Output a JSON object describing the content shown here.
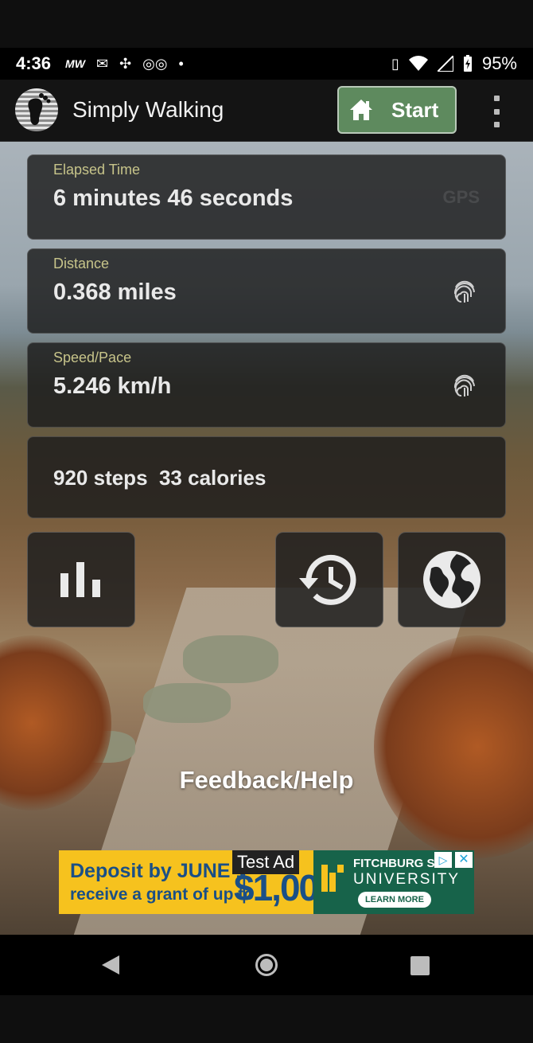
{
  "status_bar": {
    "time": "4:36",
    "battery": "95%",
    "left_icons": [
      "mw-icon",
      "gmail-icon",
      "pinwheel-icon",
      "voicemail-icon",
      "dot-icon"
    ],
    "right_icons": [
      "vibrate-icon",
      "wifi-icon",
      "signal-icon",
      "battery-charging-icon"
    ]
  },
  "app_bar": {
    "title": "Simply Walking",
    "start_label": "Start"
  },
  "cards": {
    "elapsed": {
      "label": "Elapsed Time",
      "value": "6 minutes 46 seconds",
      "gps": "GPS"
    },
    "distance": {
      "label": "Distance",
      "value": "0.368 miles"
    },
    "speed": {
      "label": "Speed/Pace",
      "value": "5.246 km/h"
    },
    "summary": {
      "text": "920 steps  33 calories"
    }
  },
  "buttons": {
    "stats_icon": "bar-chart-icon",
    "history_icon": "history-icon",
    "map_icon": "globe-icon"
  },
  "feedback": "Feedback/Help",
  "ad": {
    "test_label": "Test Ad",
    "line1": "Deposit by JUNE 1",
    "line2": "receive a grant of up to",
    "amount": "$1,000",
    "university_line1": "FITCHBURG S",
    "university_line2": "UNIVERSITY",
    "cta": "LEARN MORE"
  },
  "colors": {
    "start_green": "#5e8a5e",
    "label_yellow": "#c7c48a",
    "ad_yellow": "#f6c21e",
    "ad_green": "#17634a"
  }
}
